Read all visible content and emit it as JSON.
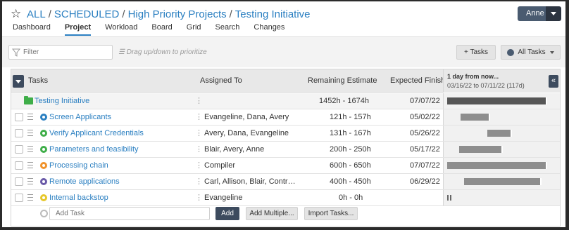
{
  "breadcrumb": {
    "items": [
      "ALL",
      "SCHEDULED",
      "High Priority Projects",
      "Testing Initiative"
    ],
    "separator": "/"
  },
  "user": {
    "name": "Anne"
  },
  "nav": {
    "tabs": [
      {
        "label": "Dashboard",
        "active": false
      },
      {
        "label": "Project",
        "active": true
      },
      {
        "label": "Workload",
        "active": false
      },
      {
        "label": "Board",
        "active": false
      },
      {
        "label": "Grid",
        "active": false
      },
      {
        "label": "Search",
        "active": false
      },
      {
        "label": "Changes",
        "active": false
      }
    ]
  },
  "toolbar": {
    "filter_placeholder": "Filter",
    "hint": "Drag up/down to prioritize",
    "tasks_button": "+ Tasks",
    "all_tasks_button": "All Tasks"
  },
  "table": {
    "headers": {
      "tasks": "Tasks",
      "assigned": "Assigned To",
      "remaining": "Remaining Estimate",
      "finish": "Expected Finish",
      "gantt_title": "1 day from now...",
      "gantt_range": "03/16/22 to 07/11/22 (117d)"
    },
    "project_row": {
      "name": "Testing Initiative",
      "remaining": "1452h - 1674h",
      "finish": "07/07/22"
    },
    "rows": [
      {
        "name": "Screen Applicants",
        "assigned": "Evangeline, Dana, Avery",
        "remaining": "121h - 157h",
        "finish": "05/02/22",
        "status_color": "#2a7fc1"
      },
      {
        "name": "Verify Applicant Credentials",
        "assigned": "Avery, Dana, Evangeline",
        "remaining": "131h - 167h",
        "finish": "05/26/22",
        "status_color": "#3fae49"
      },
      {
        "name": "Parameters and feasibility",
        "assigned": "Blair, Avery, Anne",
        "remaining": "200h - 250h",
        "finish": "05/17/22",
        "status_color": "#3fae49"
      },
      {
        "name": "Processing chain",
        "assigned": "Compiler",
        "remaining": "600h - 650h",
        "finish": "07/07/22",
        "status_color": "#f0922b"
      },
      {
        "name": "Remote applications",
        "assigned": "Carl, Allison, Blair, Contract...",
        "remaining": "400h - 450h",
        "finish": "06/29/22",
        "status_color": "#6a5aa8"
      },
      {
        "name": "Internal backstop",
        "assigned": "Evangeline",
        "remaining": "0h - 0h",
        "finish": "",
        "status_color": "#e6c72a"
      }
    ]
  },
  "add_row": {
    "placeholder": "Add Task",
    "add_button": "Add",
    "add_multiple_button": "Add Multiple...",
    "import_button": "Import Tasks..."
  }
}
